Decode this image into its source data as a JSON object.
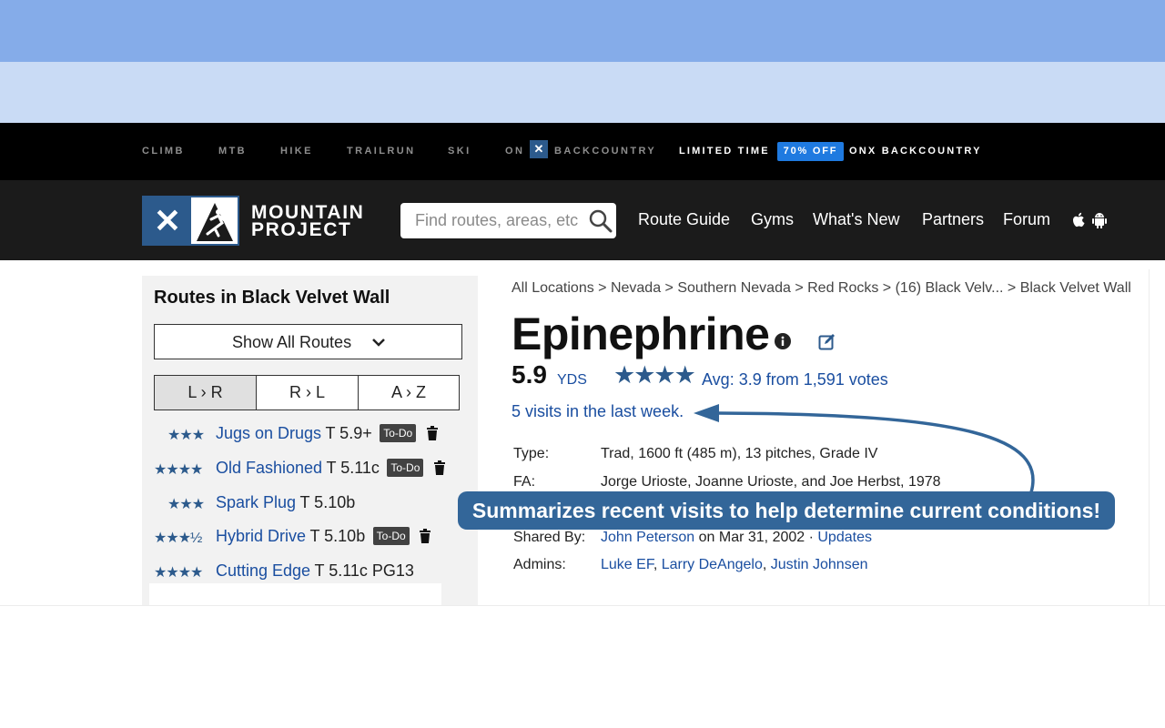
{
  "topbar": {
    "links": [
      "CLIMB",
      "MTB",
      "HIKE",
      "TRAILRUN",
      "SKI"
    ],
    "on_label": "ON",
    "backcountry_label": "BACKCOUNTRY",
    "promo_prefix": "LIMITED TIME",
    "promo_badge": "70% OFF",
    "promo_suffix": "ONX BACKCOUNTRY"
  },
  "header": {
    "logo_line1": "MOUNTAIN",
    "logo_line2": "PROJECT",
    "search_placeholder": "Find routes, areas, etc",
    "nav": [
      "Route Guide",
      "Gyms",
      "What's New",
      "Partners",
      "Forum"
    ]
  },
  "sidebar": {
    "title": "Routes in Black Velvet Wall",
    "show_all": "Show All Routes",
    "sort": [
      "L › R",
      "R › L",
      "A › Z"
    ],
    "todo_label": "To-Do",
    "routes": [
      {
        "stars": "★★★",
        "name": "Jugs on Drugs",
        "grade": "T 5.9+",
        "todo": true
      },
      {
        "stars": "★★★★",
        "name": "Old Fashioned",
        "grade": "T 5.11c",
        "todo": true
      },
      {
        "stars": "★★★",
        "name": "Spark Plug",
        "grade": "T 5.10b",
        "todo": false
      },
      {
        "stars": "★★★½",
        "name": "Hybrid Drive",
        "grade": "T 5.10b",
        "todo": true
      },
      {
        "stars": "★★★★",
        "name": "Cutting Edge",
        "grade": "T 5.11c PG13",
        "todo": false
      }
    ]
  },
  "main": {
    "breadcrumb": [
      "All Locations",
      "Nevada",
      "Southern Nevada",
      "Red Rocks",
      "(16) Black Velv...",
      "Black Velvet Wall"
    ],
    "title": "Epinephrine",
    "grade": "5.9",
    "grade_system": "YDS",
    "stars": "★★★★",
    "rating_text": "Avg: 3.9 from 1,591 votes",
    "visits_text": "5 visits in the last week.",
    "details": {
      "type_label": "Type:",
      "type_value": "Trad, 1600 ft (485 m), 13 pitches, Grade IV",
      "fa_label": "FA:",
      "fa_value": "Jorge Urioste, Joanne Urioste, and Joe Herbst, 1978",
      "shared_label": "Shared By:",
      "shared_name": "John Peterson",
      "shared_date": " on Mar 31, 2002 · ",
      "updates": "Updates",
      "admins_label": "Admins:",
      "admins": [
        "Luke EF",
        "Larry DeAngelo",
        "Justin Johnsen"
      ]
    }
  },
  "callout": {
    "text": "Summarizes recent visits to help determine current conditions!"
  },
  "colors": {
    "brand_blue": "#2c5a8c",
    "link_blue": "#1a4ea0",
    "callout_blue": "#336699",
    "badge_blue": "#1f7ae0"
  }
}
